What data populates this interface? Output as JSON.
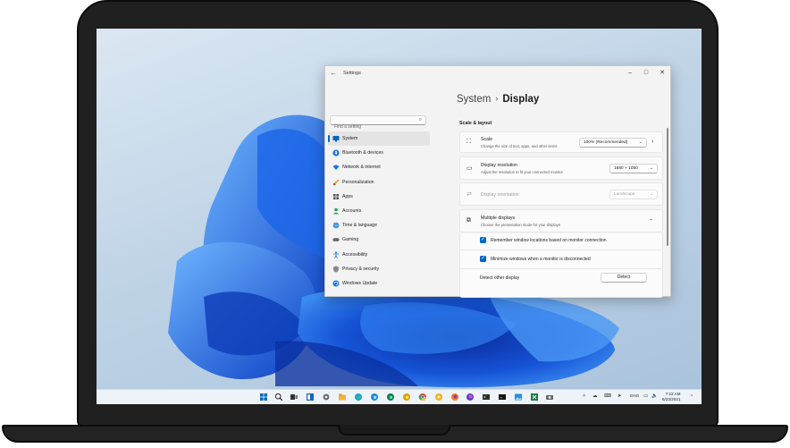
{
  "window": {
    "title": "Settings"
  },
  "search": {
    "placeholder": "Find a setting"
  },
  "nav": [
    {
      "label": "System",
      "icon": "monitor-icon"
    },
    {
      "label": "Bluetooth & devices",
      "icon": "bluetooth-icon"
    },
    {
      "label": "Network & internet",
      "icon": "wifi-icon"
    },
    {
      "label": "Personalization",
      "icon": "brush-icon"
    },
    {
      "label": "Apps",
      "icon": "apps-icon"
    },
    {
      "label": "Accounts",
      "icon": "person-icon"
    },
    {
      "label": "Time & language",
      "icon": "globe-icon"
    },
    {
      "label": "Gaming",
      "icon": "gamepad-icon"
    },
    {
      "label": "Accessibility",
      "icon": "accessibility-icon"
    },
    {
      "label": "Privacy & security",
      "icon": "shield-icon"
    },
    {
      "label": "Windows Update",
      "icon": "update-icon"
    }
  ],
  "breadcrumb": {
    "parent": "System",
    "separator": "›",
    "current": "Display"
  },
  "section_title": "Scale & layout",
  "scale": {
    "title": "Scale",
    "desc": "Change the size of text, apps, and other items",
    "value": "100% (Recommended)"
  },
  "resolution": {
    "title": "Display resolution",
    "desc": "Adjust the resolution to fit your connected monitor",
    "value": "1680 × 1050"
  },
  "orientation": {
    "title": "Display orientation",
    "value": "Landscape"
  },
  "multiple": {
    "title": "Multiple displays",
    "desc": "Choose the presentation mode for your displays",
    "remember": "Remember window locations based on monitor connection",
    "minimize": "Minimize windows when a monitor is disconnected",
    "detect_label": "Detect other display",
    "detect_button": "Detect"
  },
  "tray": {
    "lang": "ENG",
    "time": "7:22 AM",
    "date": "6/23/2021"
  },
  "colors": {
    "accent": "#0067c0",
    "window_bg": "#f3f3f3",
    "card_bg": "#fbfbfb",
    "bezel": "#202020"
  }
}
